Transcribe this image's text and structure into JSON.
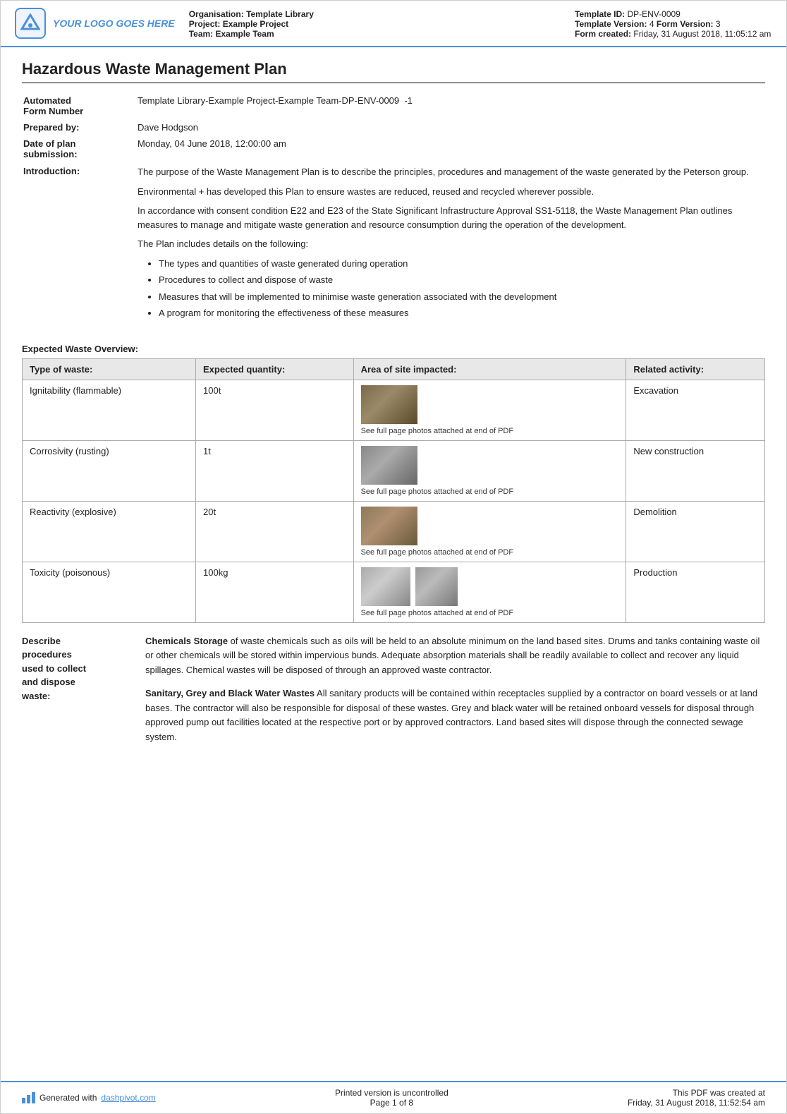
{
  "header": {
    "logo_text": "YOUR LOGO GOES HERE",
    "org_label": "Organisation:",
    "org_value": "Template Library",
    "project_label": "Project:",
    "project_value": "Example Project",
    "team_label": "Team:",
    "team_value": "Example Team",
    "template_id_label": "Template ID:",
    "template_id_value": "DP-ENV-0009",
    "template_version_label": "Template Version:",
    "template_version_value": "4",
    "form_version_label": "Form Version:",
    "form_version_value": "3",
    "form_created_label": "Form created:",
    "form_created_value": "Friday, 31 August 2018, 11:05:12 am"
  },
  "document": {
    "title": "Hazardous Waste Management Plan",
    "meta": [
      {
        "label": "Automated\nForm Number",
        "value": "Template Library-Example Project-Example Team-DP-ENV-0009  -1"
      },
      {
        "label": "Prepared by:",
        "value": "Dave Hodgson"
      },
      {
        "label": "Date of plan\nsubmission:",
        "value": "Monday, 04 June 2018, 12:00:00 am"
      },
      {
        "label": "Introduction:",
        "value": ""
      }
    ],
    "intro_paragraphs": [
      "The purpose of the Waste Management Plan is to describe the principles, procedures and management of the waste generated by the Peterson group.",
      "Environmental + has developed this Plan to ensure wastes are reduced, reused and recycled wherever possible.",
      "In accordance with consent condition E22 and E23 of the State Significant Infrastructure Approval SS1-5118, the Waste Management Plan outlines measures to manage and mitigate waste generation and resource consumption during the operation of the development.",
      "The Plan includes details on the following:"
    ],
    "bullet_items": [
      "The types and quantities of waste generated during operation",
      "Procedures to collect and dispose of waste",
      "Measures that will be implemented to minimise waste generation associated with the development",
      "A program for monitoring the effectiveness of these measures"
    ],
    "expected_waste_title": "Expected Waste Overview:",
    "table_headers": [
      "Type of waste:",
      "Expected quantity:",
      "Area of site impacted:",
      "Related activity:"
    ],
    "table_rows": [
      {
        "type": "Ignitability (flammable)",
        "quantity": "100t",
        "img_class": "excavation",
        "img_caption": "See full page photos attached at end of PDF",
        "activity": "Excavation"
      },
      {
        "type": "Corrosivity (rusting)",
        "quantity": "1t",
        "img_class": "construction",
        "img_caption": "See full page photos attached at end of PDF",
        "activity": "New construction"
      },
      {
        "type": "Reactivity (explosive)",
        "quantity": "20t",
        "img_class": "demolition",
        "img_caption": "See full page photos attached at end of PDF",
        "activity": "Demolition"
      },
      {
        "type": "Toxicity (poisonous)",
        "quantity": "100kg",
        "img_class": "toxicity1 toxicity2",
        "img_caption": "See full page photos attached at end of PDF",
        "activity": "Production"
      }
    ],
    "describe_label": "Describe\nprocedures\nused to collect\nand dispose\nwaste:",
    "describe_paragraphs": [
      "<strong>Chemicals Storage</strong> of waste chemicals such as oils will be held to an absolute minimum on the land based sites. Drums and tanks containing waste oil or other chemicals will be stored within impervious bunds. Adequate absorption materials shall be readily available to collect and recover any liquid spillages. Chemical wastes will be disposed of through an approved waste contractor.",
      "<strong>Sanitary, Grey and Black Water Wastes</strong> All sanitary products will be contained within receptacles supplied by a contractor on board vessels or at land bases. The contractor will also be responsible for disposal of these wastes. Grey and black water will be retained onboard vessels for disposal through approved pump out facilities located at the respective port or by approved contractors. Land based sites will dispose through the connected sewage system."
    ]
  },
  "footer": {
    "generated_text": "Generated with",
    "link_text": "dashpivot.com",
    "uncontrolled_text": "Printed version is uncontrolled",
    "page_text": "Page 1 of 8",
    "pdf_created_text": "This PDF was created at",
    "pdf_created_date": "Friday, 31 August 2018, 11:52:54 am"
  }
}
